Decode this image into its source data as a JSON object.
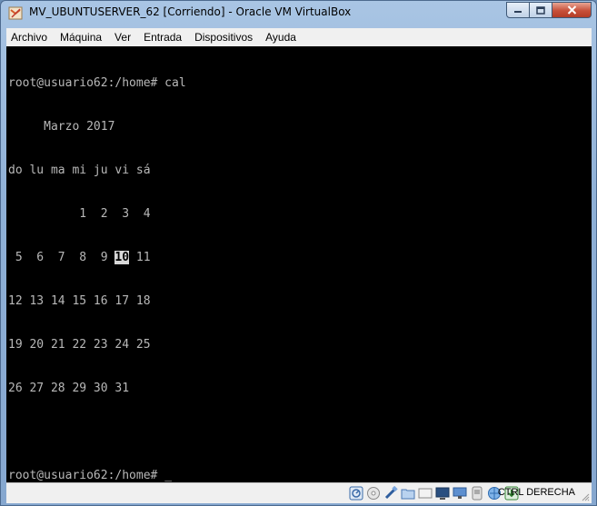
{
  "window": {
    "title": "MV_UBUNTUSERVER_62 [Corriendo] - Oracle VM VirtualBox"
  },
  "menu": [
    "Archivo",
    "Máquina",
    "Ver",
    "Entrada",
    "Dispositivos",
    "Ayuda"
  ],
  "terminal": {
    "prompt_command": "root@usuario62:/home# cal",
    "month_header": "     Marzo 2017",
    "weekdays": "do lu ma mi ju vi sá",
    "week1": "          1  2  3  4",
    "week2_before": " 5  6  7  8  9 ",
    "highlighted_day": "10",
    "week2_after": " 11",
    "week3": "12 13 14 15 16 17 18",
    "week4": "19 20 21 22 23 24 25",
    "week5": "26 27 28 29 30 31",
    "prompt_current": "root@usuario62:/home# ",
    "cursor": "_"
  },
  "statusbar": {
    "icons": [
      "hard-disk-icon",
      "optical-drive-icon",
      "usb-icon",
      "shared-folders-icon",
      "display-icon",
      "screen-capture-icon",
      "network-icon",
      "video-capture-icon",
      "virtualization-icon",
      "mouse-integration-icon"
    ],
    "host_key": "CTRL DERECHA"
  }
}
